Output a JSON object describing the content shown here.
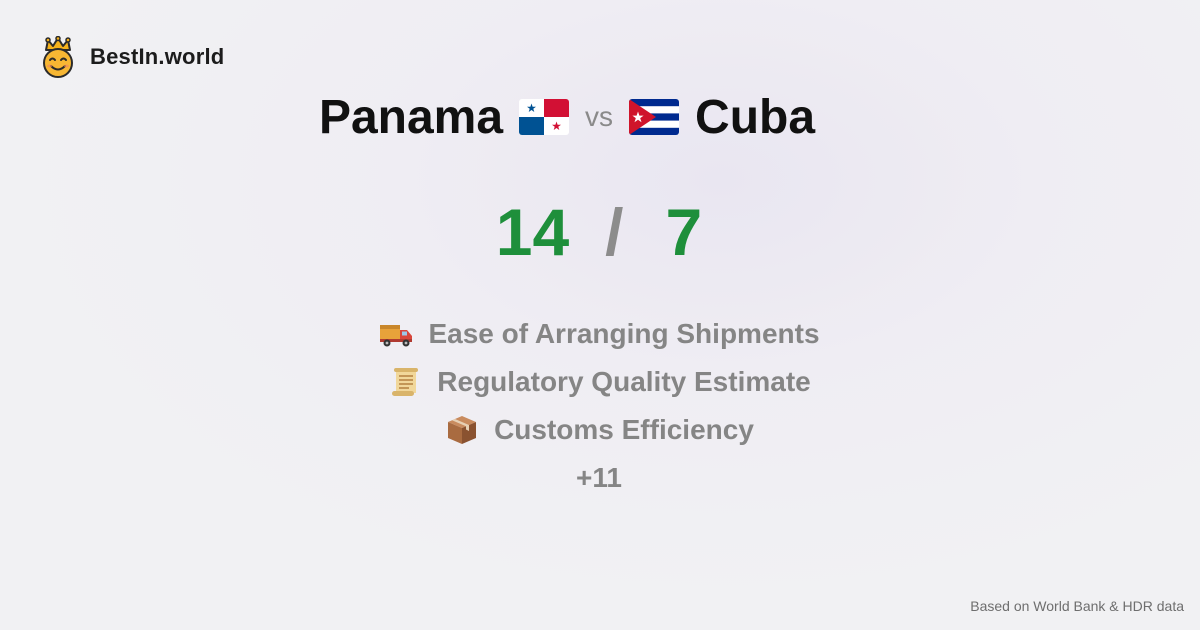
{
  "brand": {
    "name": "BestIn.world",
    "logo_icon": "crowned-smiley-icon"
  },
  "comparison": {
    "left": {
      "country": "Panama",
      "flag_icon": "panama-flag-icon"
    },
    "vs_label": "vs",
    "right": {
      "country": "Cuba",
      "flag_icon": "cuba-flag-icon"
    }
  },
  "score": {
    "left": "14",
    "separator": "/",
    "right": "7"
  },
  "metrics": [
    {
      "icon": "delivery-truck-icon",
      "label": "Ease of Arranging Shipments"
    },
    {
      "icon": "scroll-icon",
      "label": "Regulatory Quality Estimate"
    },
    {
      "icon": "package-icon",
      "label": "Customs Efficiency"
    }
  ],
  "more_label": "+11",
  "footer": {
    "source_text": "Based on World Bank & HDR data"
  },
  "colors": {
    "score_green": "#1e8f3b",
    "muted_text": "#858585",
    "title_text": "#111111"
  }
}
